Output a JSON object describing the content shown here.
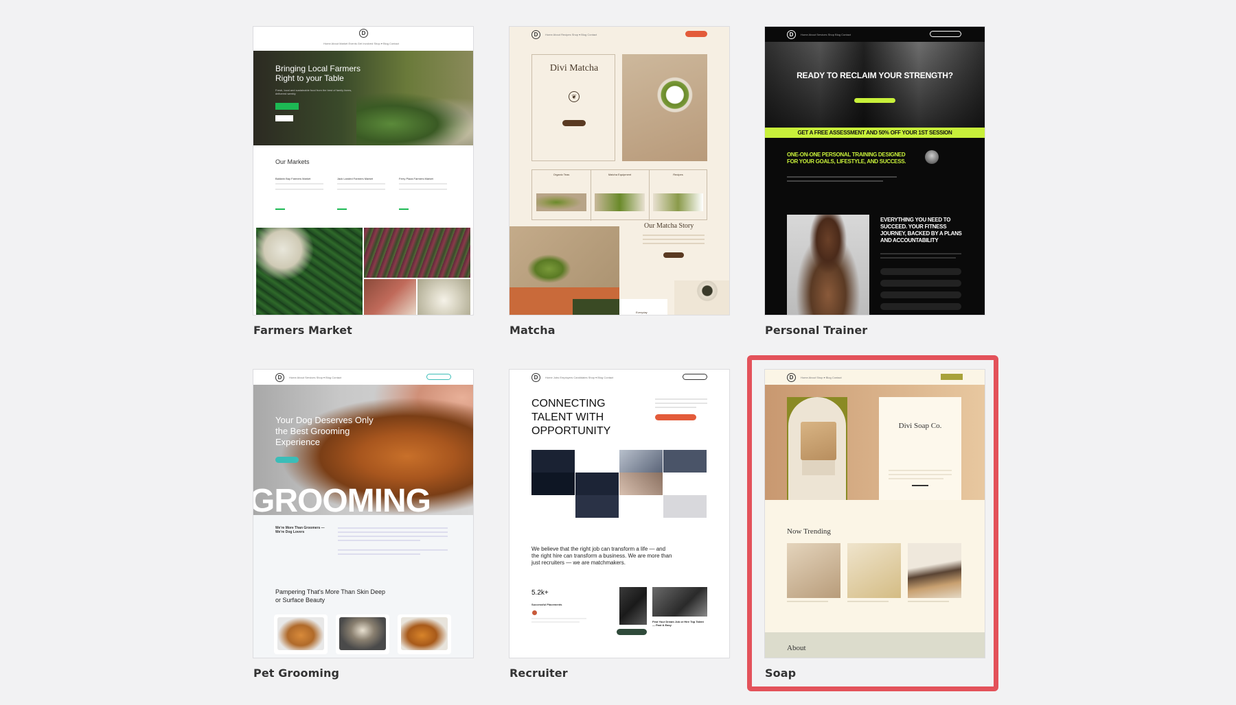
{
  "templates": [
    {
      "name": "Farmers Market",
      "nav": "Home  About  Market  Events  Get Involved  Shop ▾  Blog  Contact",
      "hero_title": "Bringing Local Farmers Right to your Table",
      "section_title": "Our Markets",
      "markets": [
        "Baldwin Bay Farmers Market",
        "Jack Landed Farmers Market",
        "Ferry Plaza Farmers Market"
      ]
    },
    {
      "name": "Matcha",
      "nav": "Home  About  Recipes  Shop ▾  Blog  Contact",
      "brand": "Divi Matcha",
      "columns": [
        "Organic Teas",
        "Matcha Equipment",
        "Recipes"
      ],
      "story_title": "Our Matcha Story",
      "story_sub": "Everyday"
    },
    {
      "name": "Personal Trainer",
      "nav": "Home  About  Services  Shop  Blog  Contact",
      "hero_title": "READY TO RECLAIM YOUR STRENGTH?",
      "banner": "GET A FREE ASSESSMENT AND 50% OFF YOUR 1ST SESSION",
      "headline": "ONE-ON-ONE PERSONAL TRAINING DESIGNED FOR YOUR GOALS, LIFESTYLE, AND SUCCESS.",
      "feature_title": "EVERYTHING YOU NEED TO SUCCEED. YOUR FITNESS JOURNEY, BACKED BY A PLANS AND ACCOUNTABILITY"
    },
    {
      "name": "Pet Grooming",
      "nav": "Home  About  Services  Shop ▾  Blog  Contact",
      "hero_title": "Your Dog Deserves Only the Best Grooming Experience",
      "big_word": "GROOMING",
      "tagline": "We're More Than Groomers — We're Dog Lovers",
      "section_title": "Pampering That's More Than Skin Deep or Surface Beauty"
    },
    {
      "name": "Recruiter",
      "nav": "Home  Jobs  Employers  Candidates  Shop ▾  Blog  Contact",
      "hero_title": "CONNECTING TALENT WITH OPPORTUNITY",
      "body": "We believe that the right job can transform a life — and the right hire can transform a business. We are more than just recruiters — we are matchmakers.",
      "stat": "5.2k+",
      "stat_label": "Successful Placements",
      "post_title": "Find Your Dream Job or Hire Top Talent — Fast & Easy"
    },
    {
      "name": "Soap",
      "nav": "Home  About  Shop ▾  Blog  Contact",
      "brand": "Divi Soap Co.",
      "section_title": "Now Trending",
      "footer_label": "About"
    }
  ],
  "selected": "Soap",
  "colors": {
    "selection": "#e3525a",
    "farm_green": "#1db954",
    "matcha_brown": "#5a3a22",
    "trainer_lime": "#c8f03a",
    "grooming_teal": "#3bbdb8",
    "recruiter_orange": "#e35b3a",
    "soap_olive": "#a8a23a"
  }
}
